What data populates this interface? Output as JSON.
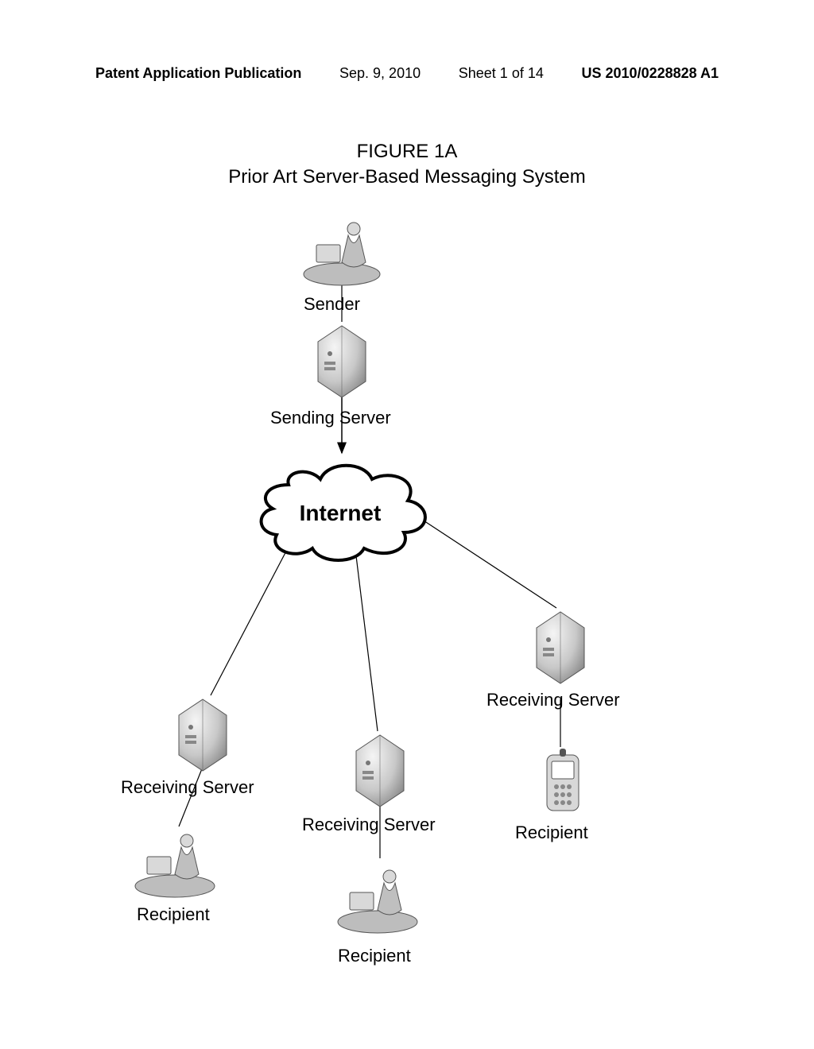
{
  "header": {
    "left": "Patent Application Publication",
    "date": "Sep. 9, 2010",
    "sheet": "Sheet 1 of 14",
    "pubno": "US 2010/0228828 A1"
  },
  "figure": {
    "title_line1": "FIGURE 1A",
    "title_line2": "Prior Art Server-Based Messaging System"
  },
  "labels": {
    "sender": "Sender",
    "sending_server": "Sending Server",
    "internet": "Internet",
    "rx_server_left": "Receiving Server",
    "rx_server_mid": "Receiving Server",
    "rx_server_right": "Receiving Server",
    "recipient_left": "Recipient",
    "recipient_mid": "Recipient",
    "recipient_right": "Recipient"
  }
}
